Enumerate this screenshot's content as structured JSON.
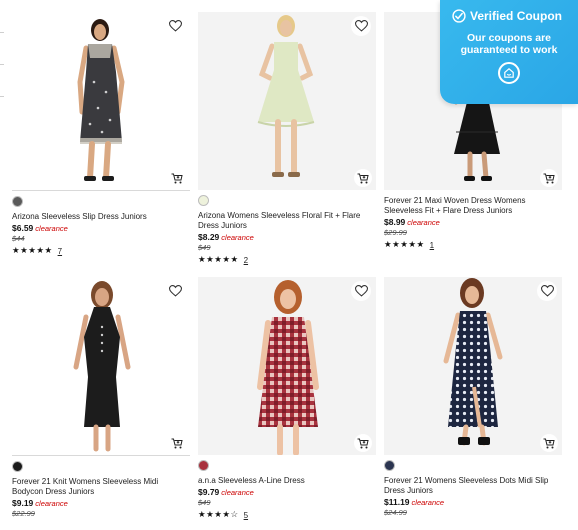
{
  "coupon": {
    "title": "Verified Coupon",
    "message": "Our coupons are guaranteed to work",
    "icons": [
      "verified-check-icon",
      "house-logo-icon"
    ]
  },
  "products": [
    {
      "title": "Arizona Sleeveless Slip Dress Juniors",
      "price": "$6.59",
      "tag": "clearance",
      "original": "$44",
      "stars": "★★★★★",
      "rating": 4.5,
      "reviews": "7",
      "swatch_color": "#5a5a5a"
    },
    {
      "title": "Arizona Womens Sleeveless Floral Fit + Flare Dress Juniors",
      "price": "$8.29",
      "tag": "clearance",
      "original": "$49",
      "stars": "★★★★★",
      "rating": 5,
      "reviews": "2",
      "swatch_color": "#eef2dc"
    },
    {
      "title": "Forever 21 Maxi Woven Dress Womens Sleeveless Fit + Flare Dress Juniors",
      "price": "$8.99",
      "tag": "clearance",
      "original": "$29.99",
      "stars": "★★★★★",
      "rating": 5,
      "reviews": "1",
      "swatch_color": null
    },
    {
      "title": "Forever 21 Knit Womens Sleeveless Midi Bodycon Dress Juniors",
      "price": "$9.19",
      "tag": "clearance",
      "original": "$22.99",
      "stars": "",
      "rating": null,
      "reviews": "",
      "swatch_color": "#1a1a1a"
    },
    {
      "title": "a.n.a Sleeveless A-Line Dress",
      "price": "$9.79",
      "tag": "clearance",
      "original": "$49",
      "stars": "★★★★☆",
      "rating": 4,
      "reviews": "5",
      "swatch_color": "#a8323e"
    },
    {
      "title": "Forever 21 Womens Sleeveless Dots Midi Slip Dress Juniors",
      "price": "$11.19",
      "tag": "clearance",
      "original": "$24.99",
      "stars": "",
      "rating": null,
      "reviews": "",
      "swatch_color": "#2b3550"
    }
  ],
  "colors": {
    "clearance": "#cc0000",
    "coupon_bg": "#38b9ee"
  }
}
